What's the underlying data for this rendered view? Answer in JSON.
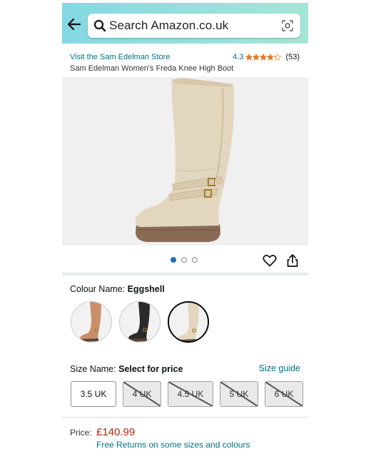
{
  "header": {
    "search_placeholder": "Search Amazon.co.uk",
    "gradient_start": "#84d8e3",
    "gradient_end": "#a5e6d6"
  },
  "product": {
    "store_link": "Visit the Sam Edelman Store",
    "rating_value": "4.3",
    "rating_stars": 4.3,
    "rating_count": "(53)",
    "title": "Sam Edelman Women's Freda Knee High Boot",
    "image_count": 3,
    "active_image_index": 0
  },
  "colour": {
    "label": "Colour Name: ",
    "selected": "Eggshell",
    "swatches": [
      {
        "name": "tan-boot-swatch",
        "color": "#c98f6a",
        "selected": false
      },
      {
        "name": "black-boot-swatch",
        "color": "#2a2a2a",
        "selected": false
      },
      {
        "name": "eggshell-boot-swatch",
        "color": "#e3d6bf",
        "selected": true
      }
    ]
  },
  "size": {
    "label": "Size Name: ",
    "selected": "Select for price",
    "guide_link": "Size guide",
    "options": [
      {
        "label": "3.5 UK",
        "available": true
      },
      {
        "label": "4 UK",
        "available": false
      },
      {
        "label": "4.5 UK",
        "available": false
      },
      {
        "label": "5 UK",
        "available": false
      },
      {
        "label": "6 UK",
        "available": false
      }
    ]
  },
  "price": {
    "label": "Price:",
    "value": "£140.99",
    "returns_link": "Free Returns on some sizes and colours"
  },
  "colors": {
    "link": "#007185",
    "price": "#b12704",
    "star": "#de7921",
    "dot_active": "#1f6fb2"
  }
}
